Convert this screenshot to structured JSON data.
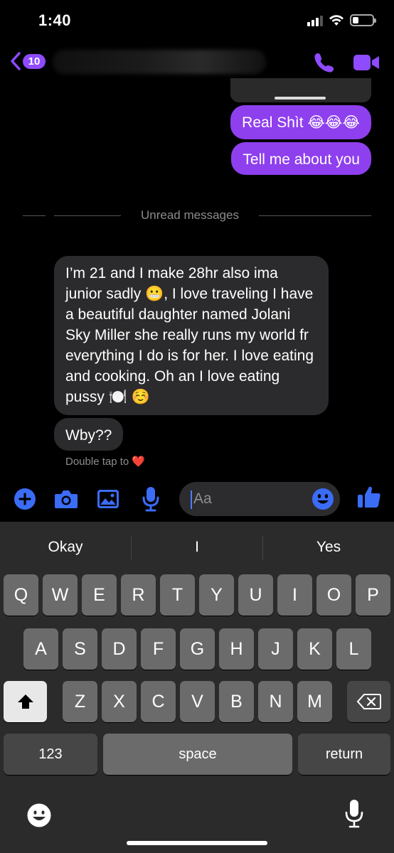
{
  "status_bar": {
    "time": "1:40",
    "battery_level": 0.3
  },
  "header": {
    "back_badge": "10",
    "icons": [
      "chevron-left-icon",
      "phone-icon",
      "video-camera-icon"
    ],
    "accent_color": "#8e4bff"
  },
  "messages": {
    "outgoing": [
      "Real Shìt 😂😂😂",
      "Tell me about you"
    ],
    "divider_label": "Unread messages",
    "incoming": [
      "I’m 21 and I make 28hr also ima junior sadly 😬, I love traveling I have a beautiful daughter named Jolani Sky Miller she really runs my world fr everything I do is for her. I love eating and cooking. Oh an I love eating pussy 🍽️ ☺️",
      "Wby??"
    ],
    "reaction_hint": "Double tap to ❤️"
  },
  "composer": {
    "placeholder": "Aa",
    "icons": [
      "plus-icon",
      "camera-icon",
      "image-icon",
      "microphone-icon",
      "emoji-icon",
      "thumbs-up-icon"
    ]
  },
  "keyboard": {
    "suggestions": [
      "Okay",
      "I",
      "Yes"
    ],
    "row1": [
      "Q",
      "W",
      "E",
      "R",
      "T",
      "Y",
      "U",
      "I",
      "O",
      "P"
    ],
    "row2": [
      "A",
      "S",
      "D",
      "F",
      "G",
      "H",
      "J",
      "K",
      "L"
    ],
    "row3": [
      "Z",
      "X",
      "C",
      "V",
      "B",
      "N",
      "M"
    ],
    "numbers_label": "123",
    "space_label": "space",
    "return_label": "return"
  }
}
